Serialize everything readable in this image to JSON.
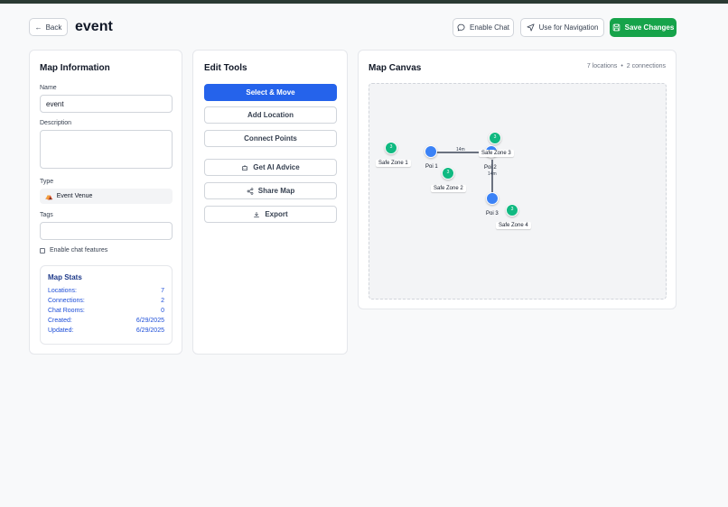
{
  "header": {
    "back_label": "Back",
    "title": "event",
    "enable_chat_label": "Enable Chat",
    "navigation_label": "Use for Navigation",
    "save_label": "Save Changes"
  },
  "colors": {
    "primary": "#2563eb",
    "success": "#16a34a",
    "safe_zone": "#10b981",
    "poi": "#3b82f6"
  },
  "map_info": {
    "title": "Map Information",
    "name_label": "Name",
    "name_value": "event",
    "description_label": "Description",
    "description_value": "",
    "type_label": "Type",
    "type_icon": "circus-tent-icon",
    "type_value": "Event Venue",
    "tags_label": "Tags",
    "tags_value": "",
    "chat_checkbox_label": "Enable chat features",
    "chat_checkbox_checked": false,
    "stats": {
      "title": "Map Stats",
      "rows": [
        {
          "label": "Locations:",
          "value": "7"
        },
        {
          "label": "Connections:",
          "value": "2"
        },
        {
          "label": "Chat Rooms:",
          "value": "0"
        },
        {
          "label": "Created:",
          "value": "6/29/2025"
        },
        {
          "label": "Updated:",
          "value": "6/29/2025"
        }
      ]
    }
  },
  "edit_tools": {
    "title": "Edit Tools",
    "buttons": [
      {
        "label": "Select & Move",
        "icon": "",
        "active": true
      },
      {
        "label": "Add Location",
        "icon": ""
      },
      {
        "label": "Connect Points",
        "icon": ""
      },
      {
        "label": "Get AI Advice",
        "icon": "robot-icon"
      },
      {
        "label": "Share Map",
        "icon": "share-icon"
      },
      {
        "label": "Export",
        "icon": "download-icon"
      }
    ]
  },
  "map_canvas": {
    "title": "Map Canvas",
    "locations_text": "7 locations",
    "separator": "•",
    "connections_text": "2 connections",
    "nodes": [
      {
        "label": "Safe Zone 1",
        "kind": "safe-zone"
      },
      {
        "label": "Poi 1",
        "kind": "poi"
      },
      {
        "label": "Safe Zone 2",
        "kind": "safe-zone"
      },
      {
        "label": "Safe Zone 3",
        "kind": "safe-zone"
      },
      {
        "label": "Poi 2",
        "kind": "poi"
      },
      {
        "label": "Poi 3",
        "kind": "poi"
      },
      {
        "label": "Safe Zone 4",
        "kind": "safe-zone"
      }
    ],
    "connections": [
      {
        "from": "Poi 1",
        "to": "Poi 2",
        "distance": "14m"
      },
      {
        "from": "Poi 2",
        "to": "Poi 3",
        "distance": "14m"
      }
    ]
  }
}
